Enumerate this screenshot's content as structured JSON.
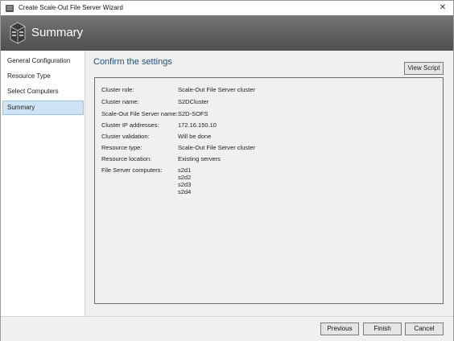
{
  "window": {
    "title": "Create Scale-Out File Server Wizard",
    "close_glyph": "✕"
  },
  "banner": {
    "title": "Summary",
    "icon": "server-wizard-icon"
  },
  "sidebar": {
    "items": [
      {
        "label": "General Configuration",
        "selected": false
      },
      {
        "label": "Resource Type",
        "selected": false
      },
      {
        "label": "Select Computers",
        "selected": false
      },
      {
        "label": "Summary",
        "selected": true
      }
    ]
  },
  "main": {
    "heading": "Confirm the settings",
    "view_script_label": "View Script",
    "settings": [
      {
        "label": "Cluster role:",
        "value": "Scale-Out File Server cluster"
      },
      {
        "label": "Cluster name:",
        "value": "S2DCluster"
      },
      {
        "label": "Scale-Out File Server name:",
        "value": "S2D-SOFS"
      },
      {
        "label": "Cluster IP addresses:",
        "value": "172.16.150.10"
      },
      {
        "label": "Cluster validation:",
        "value": "Will be done"
      },
      {
        "label": "Resource type:",
        "value": "Scale-Out File Server cluster"
      },
      {
        "label": "Resource location:",
        "value": "Existing servers"
      },
      {
        "label": "File Server computers:",
        "value": "s2d1"
      }
    ],
    "extra_computers": [
      "s2d2",
      "s2d3",
      "s2d4"
    ]
  },
  "footer": {
    "previous_label": "Previous",
    "finish_label": "Finish",
    "cancel_label": "Cancel"
  },
  "colors": {
    "banner": "#5e5e5e",
    "heading": "#1f4e79",
    "selection": "#cfe3f7"
  }
}
